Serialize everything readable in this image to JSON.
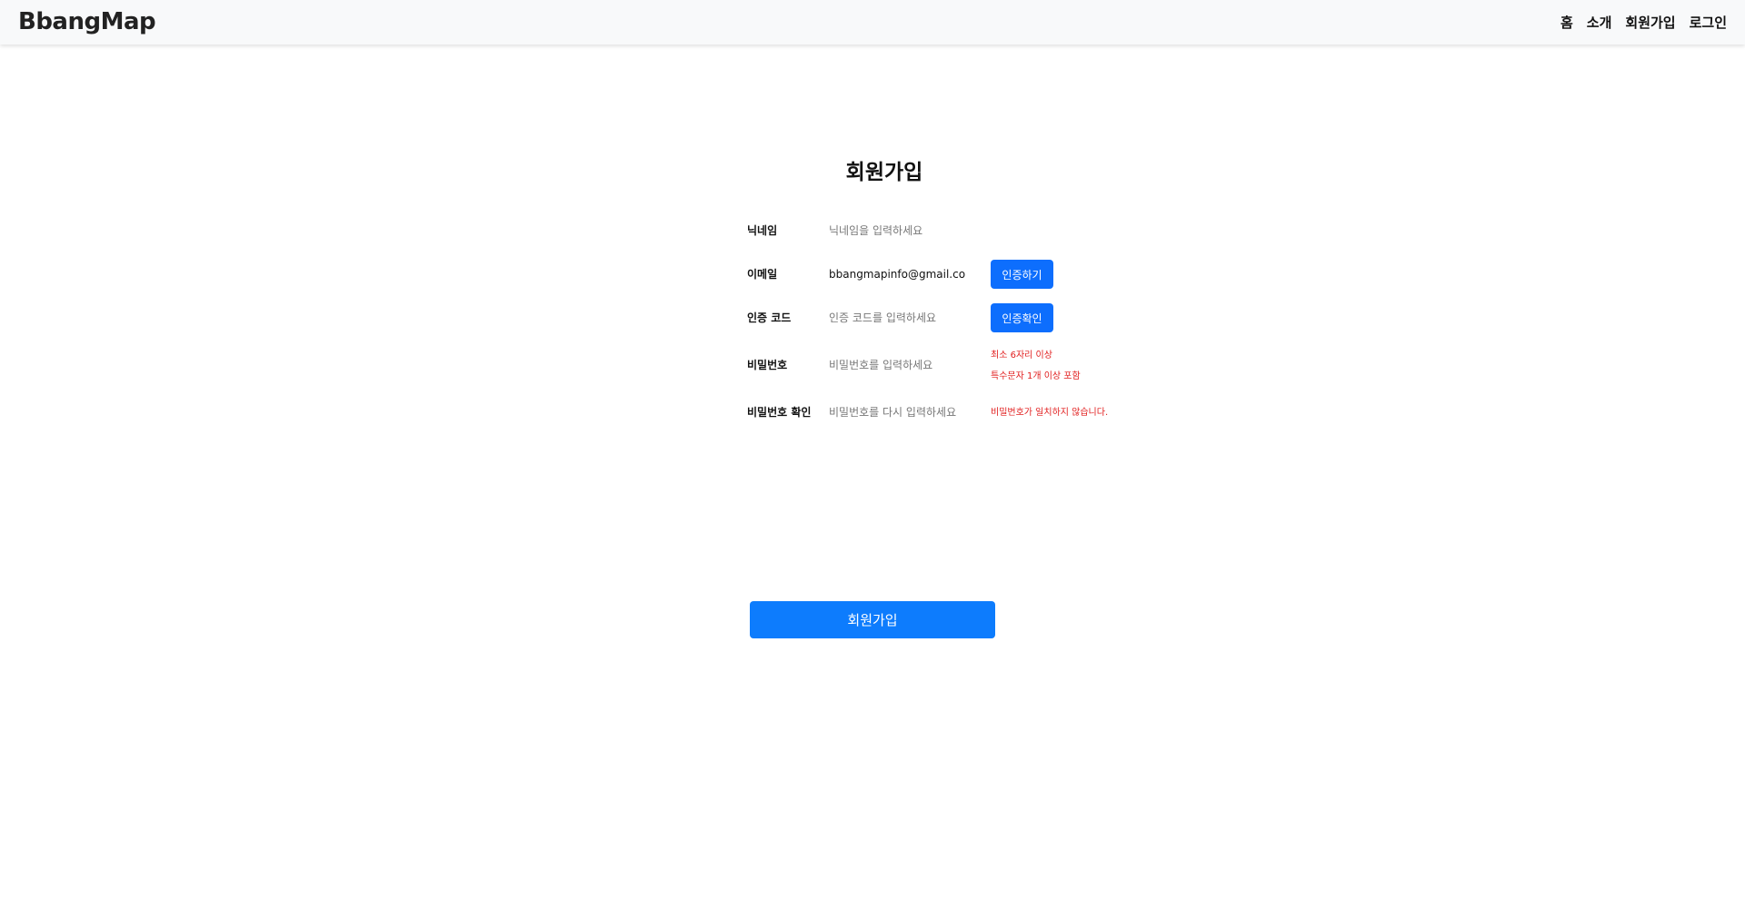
{
  "navbar": {
    "brand": "BbangMap",
    "links": [
      "홈",
      "소개",
      "회원가입",
      "로그인"
    ]
  },
  "form": {
    "title": "회원가입",
    "nickname": {
      "label": "닉네임",
      "placeholder": "닉네임을 입력하세요",
      "value": ""
    },
    "email": {
      "label": "이메일",
      "placeholder": "",
      "value": "bbangmapinfo@gmail.co",
      "button": "인증하기"
    },
    "code": {
      "label": "인증 코드",
      "placeholder": "인증 코드를 입력하세요",
      "value": "",
      "button": "인증확인"
    },
    "password": {
      "label": "비밀번호",
      "placeholder": "비밀번호를 입력하세요",
      "value": "",
      "hints": [
        "최소 6자리 이상",
        "특수문자 1개 이상 포함"
      ]
    },
    "password_confirm": {
      "label": "비밀번호 확인",
      "placeholder": "비밀번호를 다시 입력하세요",
      "value": "",
      "hint": "비밀번호가 일치하지 않습니다."
    },
    "submit": "회원가입"
  },
  "colors": {
    "primary": "#0d6efd",
    "error": "#e11d1d",
    "navbar_bg": "#f8f9fa"
  }
}
